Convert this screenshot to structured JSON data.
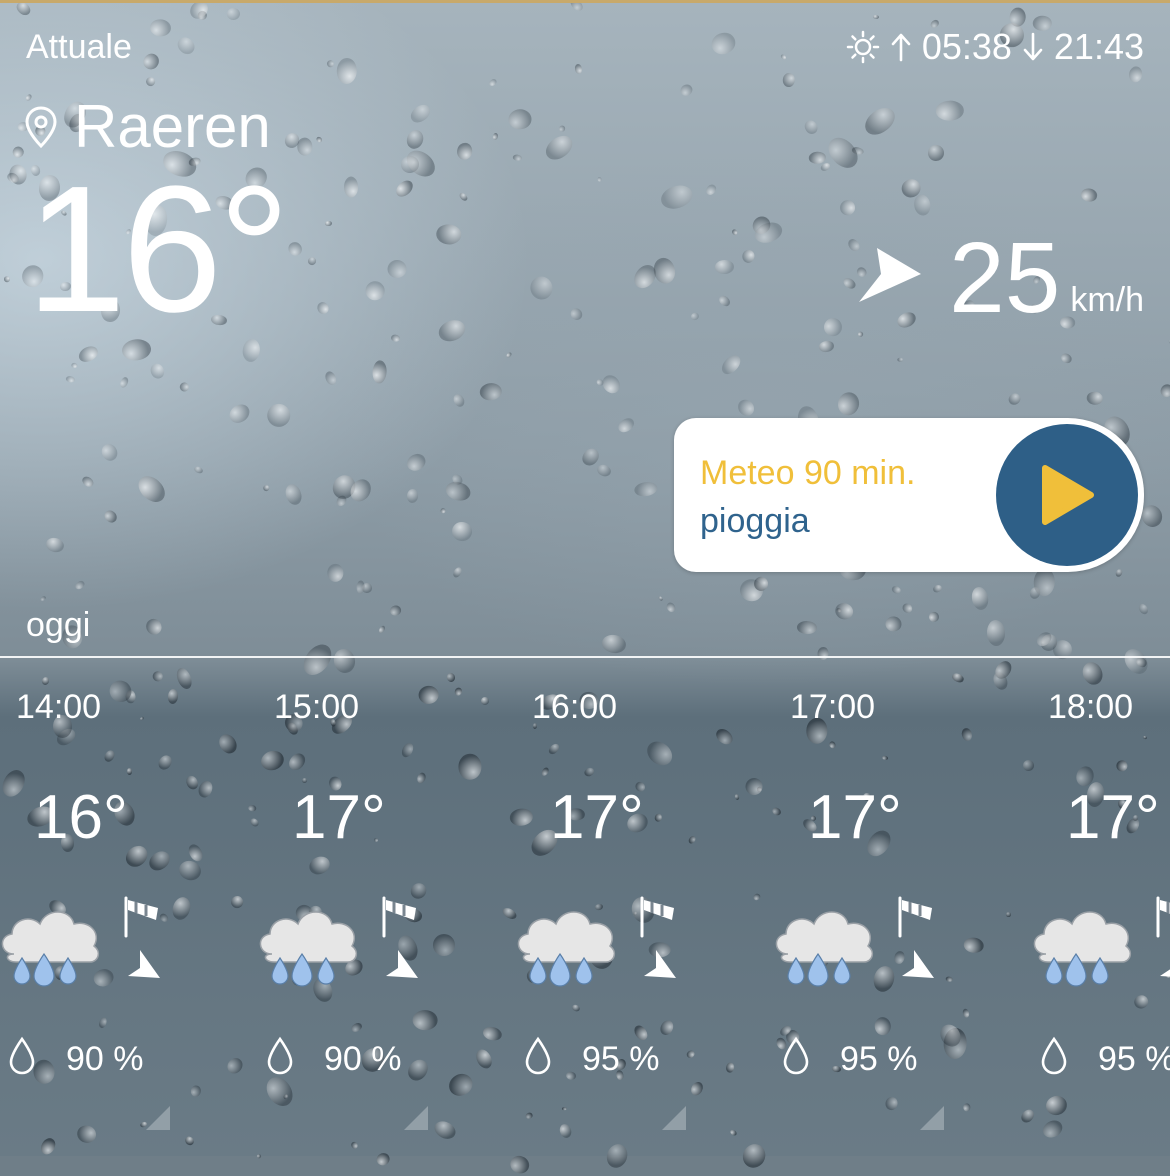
{
  "header": {
    "label": "Attuale",
    "sunrise": "05:38",
    "sunset": "21:43"
  },
  "location": {
    "city": "Raeren",
    "icon": "location-pin-icon"
  },
  "current": {
    "temperature": "16°",
    "wind_speed": "25",
    "wind_unit": "km/h"
  },
  "radar_card": {
    "title": "Meteo 90 min.",
    "subtitle": "pioggia",
    "title_color": "#f0bf3a",
    "subtitle_color": "#2f638d",
    "button_color": "#2e5f87",
    "play_color": "#f0bf3a"
  },
  "section_label": "oggi",
  "hourly": [
    {
      "time": "14:00",
      "temp": "16°",
      "precip": "90 %",
      "icon": "rain-cloud-icon"
    },
    {
      "time": "15:00",
      "temp": "17°",
      "precip": "90 %",
      "icon": "rain-cloud-icon"
    },
    {
      "time": "16:00",
      "temp": "17°",
      "precip": "95 %",
      "icon": "rain-cloud-icon"
    },
    {
      "time": "17:00",
      "temp": "17°",
      "precip": "95 %",
      "icon": "rain-cloud-icon"
    },
    {
      "time": "18:00",
      "temp": "17°",
      "precip": "95 %",
      "icon": "rain-cloud-icon"
    }
  ]
}
